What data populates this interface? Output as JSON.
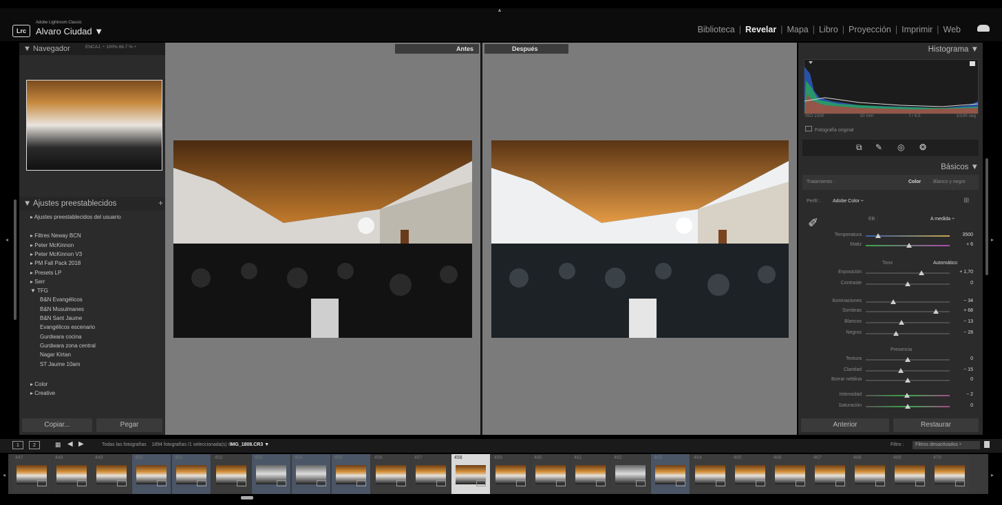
{
  "app": {
    "product": "Adobe Lightroom Classic",
    "logo": "Lrc",
    "user": "Alvaro Ciudad ▼"
  },
  "modules": [
    {
      "label": "Biblioteca",
      "active": false
    },
    {
      "label": "Revelar",
      "active": true
    },
    {
      "label": "Mapa",
      "active": false
    },
    {
      "label": "Libro",
      "active": false
    },
    {
      "label": "Proyección",
      "active": false
    },
    {
      "label": "Imprimir",
      "active": false
    },
    {
      "label": "Web",
      "active": false
    }
  ],
  "navigator": {
    "title": "▼ Navegador",
    "options": "ENCAJ. ÷  100%  66.7 % ÷"
  },
  "presets": {
    "title": "▼ Ajustes preestablecidos",
    "plus": "+",
    "items": [
      {
        "label": "▸ Ajustes preestablecidos del usuario",
        "sub": false
      },
      {
        "label": "▸ Filtres Neway BCN",
        "sub": false
      },
      {
        "label": "▸ Peter McKinnon",
        "sub": false
      },
      {
        "label": "▸ Peter McKinnon V3",
        "sub": false
      },
      {
        "label": "▸ PM Fall Pack 2018",
        "sub": false
      },
      {
        "label": "▸ Presets LP",
        "sub": false
      },
      {
        "label": "▸ Serr",
        "sub": false
      },
      {
        "label": "▼ TFG",
        "sub": false
      },
      {
        "label": "B&N Evangélicos",
        "sub": true
      },
      {
        "label": "B&N Musulmanes",
        "sub": true
      },
      {
        "label": "B&N Sant Jaume",
        "sub": true
      },
      {
        "label": "Evangélicos escenario",
        "sub": true
      },
      {
        "label": "Gurdwara cocina",
        "sub": true
      },
      {
        "label": "Gurdwara zona central",
        "sub": true
      },
      {
        "label": "Nagar Kirtan",
        "sub": true
      },
      {
        "label": "ST Jaume 10am",
        "sub": true
      },
      {
        "label": "▸ Color",
        "sub": false
      },
      {
        "label": "▸ Creative",
        "sub": false
      }
    ]
  },
  "left_buttons": {
    "copy": "Copiar...",
    "paste": "Pegar"
  },
  "view": {
    "before": "Antes",
    "after": "Después"
  },
  "histogram": {
    "title": "Histograma ▼",
    "iso": "ISO 1000",
    "focal": "10 mm",
    "aperture": "f / 4,5",
    "shutter": "1/100 seg",
    "original": "Fotografía original"
  },
  "tools": [
    "crop-icon",
    "brush-icon",
    "redeye-icon",
    "mask-icon"
  ],
  "basics": {
    "title": "Básicos ▼",
    "treatment_label": "Tratamiento :",
    "treatment_color": "Color",
    "treatment_bw": "Blanco y negro",
    "profile_label": "Perfil :",
    "profile_value": "Adobe Color ÷",
    "wb_label": "EB :",
    "wb_value": "A medida ÷",
    "tone_label": "Tono",
    "auto_label": "Automático",
    "presence_label": "Presencia",
    "sliders": [
      {
        "label": "Temperatura",
        "value": "3500",
        "pos": 0.15
      },
      {
        "label": "Matiz",
        "value": "+ 6",
        "pos": 0.52
      },
      {
        "label": "Exposición",
        "value": "+ 1,70",
        "pos": 0.66
      },
      {
        "label": "Contraste",
        "value": "0",
        "pos": 0.5
      },
      {
        "label": "Iluminaciones",
        "value": "− 34",
        "pos": 0.33
      },
      {
        "label": "Sombras",
        "value": "+ 68",
        "pos": 0.84
      },
      {
        "label": "Blancos",
        "value": "− 13",
        "pos": 0.43
      },
      {
        "label": "Negros",
        "value": "− 28",
        "pos": 0.36
      },
      {
        "label": "Textura",
        "value": "0",
        "pos": 0.5
      },
      {
        "label": "Claridad",
        "value": "− 15",
        "pos": 0.42
      },
      {
        "label": "Borrar neblina",
        "value": "0",
        "pos": 0.5
      },
      {
        "label": "Intensidad",
        "value": "− 2",
        "pos": 0.49
      },
      {
        "label": "Saturación",
        "value": "0",
        "pos": 0.5
      }
    ]
  },
  "right_buttons": {
    "previous": "Anterior",
    "reset": "Restaurar"
  },
  "filmstrip": {
    "view1": "1",
    "view2": "2",
    "source": "Todas las fotografías",
    "count": "1894 fotografías /1 seleccionada(s) /",
    "filename": "IMG_1808.CR3 ▼",
    "filter_label": "Filtro :",
    "filter_value": "Filtros desactivados ÷",
    "thumbs": [
      {
        "n": "447",
        "sel": false,
        "hl": false,
        "tone": "warm"
      },
      {
        "n": "448",
        "sel": false,
        "hl": false,
        "tone": "warm"
      },
      {
        "n": "449",
        "sel": false,
        "hl": false,
        "tone": "warm"
      },
      {
        "n": "450",
        "sel": false,
        "hl": true,
        "tone": "warm"
      },
      {
        "n": "451",
        "sel": false,
        "hl": true,
        "tone": "warm"
      },
      {
        "n": "452",
        "sel": false,
        "hl": false,
        "tone": "warm"
      },
      {
        "n": "453",
        "sel": false,
        "hl": true,
        "tone": "bw"
      },
      {
        "n": "454",
        "sel": false,
        "hl": true,
        "tone": "bw"
      },
      {
        "n": "455",
        "sel": false,
        "hl": true,
        "tone": "warm"
      },
      {
        "n": "456",
        "sel": false,
        "hl": false,
        "tone": "warm"
      },
      {
        "n": "457",
        "sel": false,
        "hl": false,
        "tone": "warm"
      },
      {
        "n": "458",
        "sel": true,
        "hl": false,
        "tone": "warm"
      },
      {
        "n": "459",
        "sel": false,
        "hl": false,
        "tone": "warm"
      },
      {
        "n": "460",
        "sel": false,
        "hl": false,
        "tone": "warm"
      },
      {
        "n": "461",
        "sel": false,
        "hl": false,
        "tone": "warm"
      },
      {
        "n": "462",
        "sel": false,
        "hl": false,
        "tone": "bw"
      },
      {
        "n": "463",
        "sel": false,
        "hl": true,
        "tone": "warm"
      },
      {
        "n": "464",
        "sel": false,
        "hl": false,
        "tone": "warm"
      },
      {
        "n": "465",
        "sel": false,
        "hl": false,
        "tone": "warm"
      },
      {
        "n": "466",
        "sel": false,
        "hl": false,
        "tone": "warm"
      },
      {
        "n": "467",
        "sel": false,
        "hl": false,
        "tone": "warm"
      },
      {
        "n": "468",
        "sel": false,
        "hl": false,
        "tone": "warm"
      },
      {
        "n": "469",
        "sel": false,
        "hl": false,
        "tone": "warm"
      },
      {
        "n": "470",
        "sel": false,
        "hl": false,
        "tone": "warm"
      }
    ]
  }
}
